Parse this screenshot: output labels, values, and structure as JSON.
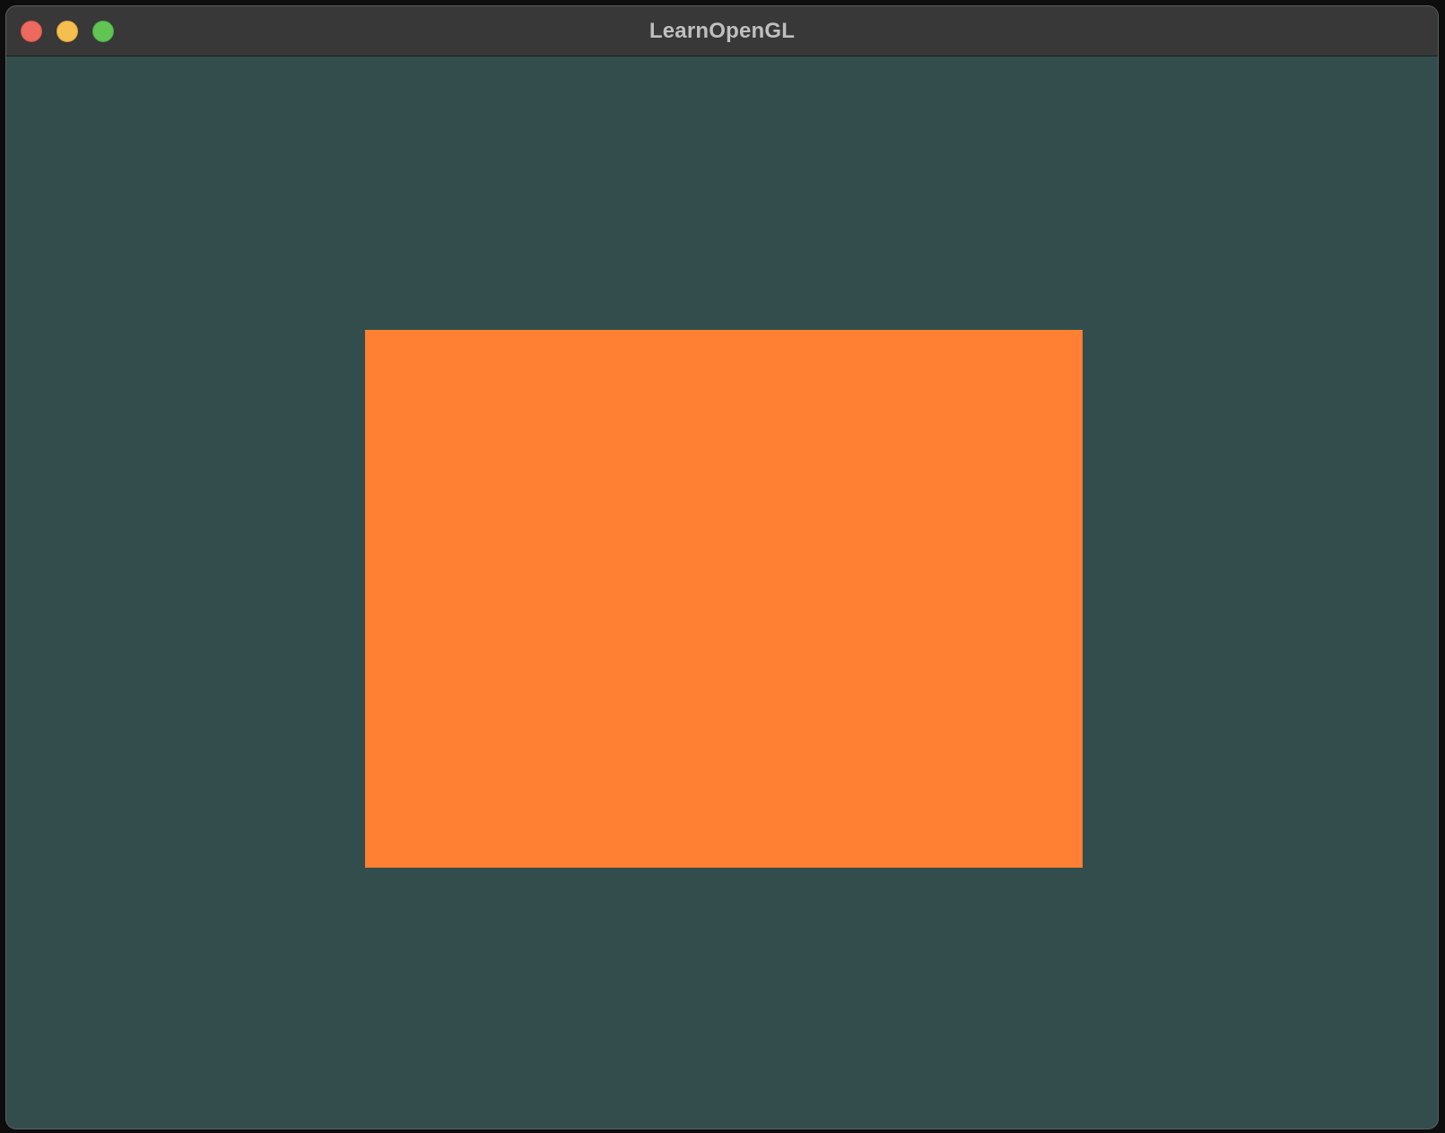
{
  "window": {
    "title": "LearnOpenGL",
    "title_color": "#bfbfbf"
  },
  "traffic_lights": {
    "close_color": "#ed6a5e",
    "minimize_color": "#f5bf4f",
    "zoom_color": "#61c554"
  },
  "canvas": {
    "clear_color": "#334d4d",
    "shape": "rectangle",
    "shape_color": "#ff8033"
  }
}
